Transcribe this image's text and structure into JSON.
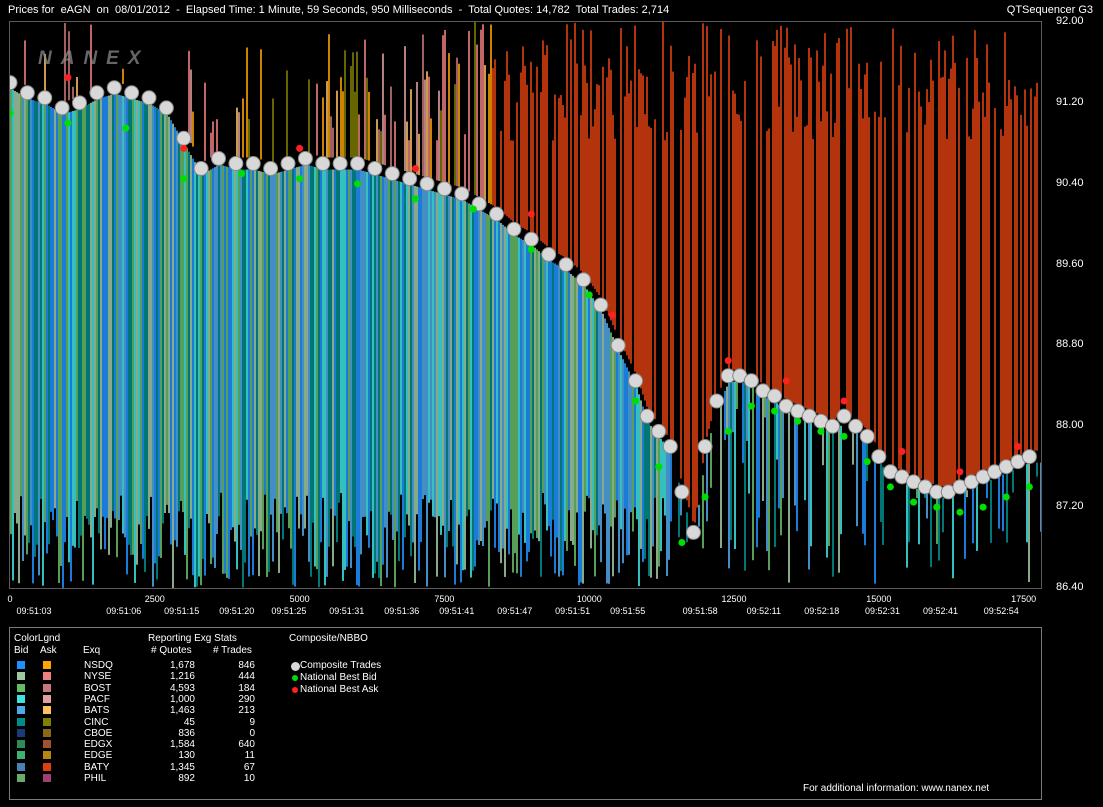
{
  "header": {
    "title": "Prices for  eAGN  on  08/01/2012  -  Elapsed Time: 1 Minute, 59 Seconds, 950 Milliseconds  -  Total Quotes: 14,782  Total Trades: 2,714",
    "app": "QTSequencer G3",
    "watermark": "NANEX"
  },
  "chart_data": {
    "type": "scatter",
    "title": "Prices for eAGN on 08/01/2012",
    "y_ticks": [
      "92.00",
      "91.20",
      "90.40",
      "89.60",
      "88.80",
      "88.00",
      "87.20",
      "86.40"
    ],
    "ylim": [
      86.4,
      92.0
    ],
    "x_numeric_ticks": [
      "0",
      "2500",
      "5000",
      "7500",
      "10000",
      "12500",
      "15000",
      "17500"
    ],
    "xlim": [
      0,
      17800
    ],
    "x_time_ticks": [
      "09:51:03",
      "09:51:06",
      "09:51:15",
      "09:51:20",
      "09:51:25",
      "09:51:31",
      "09:51:36",
      "09:51:41",
      "09:51:47",
      "09:51:51",
      "09:51:55",
      "09:51:58",
      "09:52:11",
      "09:52:18",
      "09:52:31",
      "09:52:41",
      "09:52:54"
    ],
    "x_time_positions": [
      0,
      1550,
      2550,
      3500,
      4400,
      5400,
      6350,
      7300,
      8300,
      9300,
      10250,
      11500,
      12600,
      13600,
      14650,
      15650,
      16700
    ],
    "series": [
      {
        "name": "Composite Trades",
        "color": "#d8d8d8",
        "x": [
          0,
          300,
          600,
          900,
          1200,
          1500,
          1800,
          2100,
          2400,
          2700,
          3000,
          3300,
          3600,
          3900,
          4200,
          4500,
          4800,
          5100,
          5400,
          5700,
          6000,
          6300,
          6600,
          6900,
          7200,
          7500,
          7800,
          8100,
          8400,
          8700,
          9000,
          9300,
          9600,
          9900,
          10200,
          10500,
          10800,
          11000,
          11200,
          11400,
          11600,
          11800,
          12000,
          12200,
          12400,
          12600,
          12800,
          13000,
          13200,
          13400,
          13600,
          13800,
          14000,
          14200,
          14400,
          14600,
          14800,
          15000,
          15200,
          15400,
          15600,
          15800,
          16000,
          16200,
          16400,
          16600,
          16800,
          17000,
          17200,
          17400,
          17600
        ],
        "y": [
          91.4,
          91.3,
          91.25,
          91.15,
          91.2,
          91.3,
          91.35,
          91.3,
          91.25,
          91.15,
          90.85,
          90.55,
          90.65,
          90.6,
          90.6,
          90.55,
          90.6,
          90.65,
          90.6,
          90.6,
          90.6,
          90.55,
          90.5,
          90.45,
          90.4,
          90.35,
          90.3,
          90.2,
          90.1,
          89.95,
          89.85,
          89.7,
          89.6,
          89.45,
          89.2,
          88.8,
          88.45,
          88.1,
          87.95,
          87.8,
          87.35,
          86.95,
          87.8,
          88.25,
          88.5,
          88.5,
          88.45,
          88.35,
          88.3,
          88.2,
          88.15,
          88.1,
          88.05,
          88.0,
          88.1,
          88.0,
          87.9,
          87.7,
          87.55,
          87.5,
          87.45,
          87.4,
          87.35,
          87.35,
          87.4,
          87.45,
          87.5,
          87.55,
          87.6,
          87.65,
          87.7
        ]
      },
      {
        "name": "National Best Bid",
        "color": "#00e000",
        "x": [
          0,
          1000,
          2000,
          3000,
          4000,
          5000,
          6000,
          7000,
          8000,
          9000,
          10000,
          10800,
          11200,
          11600,
          12000,
          12400,
          12800,
          13200,
          13600,
          14000,
          14400,
          14800,
          15200,
          15600,
          16000,
          16400,
          16800,
          17200,
          17600
        ],
        "y": [
          91.1,
          91.0,
          90.95,
          90.45,
          90.5,
          90.45,
          90.4,
          90.25,
          90.15,
          89.75,
          89.3,
          88.25,
          87.6,
          86.85,
          87.3,
          87.95,
          88.2,
          88.15,
          88.05,
          87.95,
          87.9,
          87.65,
          87.4,
          87.25,
          87.2,
          87.15,
          87.2,
          87.3,
          87.4
        ]
      },
      {
        "name": "National Best Ask",
        "color": "#ff2020",
        "x": [
          1000,
          3000,
          5000,
          7000,
          9000,
          10400,
          12400,
          13400,
          14400,
          15400,
          16400,
          17400
        ],
        "y": [
          91.45,
          90.75,
          90.75,
          90.55,
          90.1,
          89.1,
          88.65,
          88.45,
          88.25,
          87.75,
          87.55,
          87.8
        ]
      }
    ],
    "grid": false,
    "legend_position": "bottom-left"
  },
  "legend": {
    "col_headers": {
      "colorlgnd": "ColorLgnd",
      "bid": "Bid",
      "ask": "Ask",
      "exq": "Exq",
      "reporting": "Reporting Exg Stats",
      "quotes": "# Quotes",
      "trades": "# Trades",
      "composite": "Composite/NBBO"
    },
    "rows": [
      {
        "exq": "NSDQ",
        "quotes": "1,678",
        "trades": "846",
        "bid": "#1e90ff",
        "ask": "#ffa500"
      },
      {
        "exq": "NYSE",
        "quotes": "1,216",
        "trades": "444",
        "bid": "#a0c8a0",
        "ask": "#f08080"
      },
      {
        "exq": "BOST",
        "quotes": "4,593",
        "trades": "184",
        "bid": "#66bb66",
        "ask": "#c87878"
      },
      {
        "exq": "PACF",
        "quotes": "1,000",
        "trades": "290",
        "bid": "#40e0e0",
        "ask": "#e0a0a0"
      },
      {
        "exq": "BATS",
        "quotes": "1,463",
        "trades": "213",
        "bid": "#4fa8e8",
        "ask": "#ffc060"
      },
      {
        "exq": "CINC",
        "quotes": "45",
        "trades": "9",
        "bid": "#008b8b",
        "ask": "#808000"
      },
      {
        "exq": "CBOE",
        "quotes": "836",
        "trades": "0",
        "bid": "#1c3a7a",
        "ask": "#8b6914"
      },
      {
        "exq": "EDGX",
        "quotes": "1,584",
        "trades": "640",
        "bid": "#2e8b57",
        "ask": "#a0522d"
      },
      {
        "exq": "EDGE",
        "quotes": "130",
        "trades": "11",
        "bid": "#3cb371",
        "ask": "#b8860b"
      },
      {
        "exq": "BATY",
        "quotes": "1,345",
        "trades": "67",
        "bid": "#4682b4",
        "ask": "#e04010"
      },
      {
        "exq": "PHIL",
        "quotes": "892",
        "trades": "10",
        "bid": "#6aaa6a",
        "ask": "#a04070"
      }
    ],
    "composite_items": [
      {
        "label": "Composite Trades",
        "color": "#d8d8d8",
        "size": 9
      },
      {
        "label": "National Best Bid",
        "color": "#00e000",
        "size": 6
      },
      {
        "label": "National Best Ask",
        "color": "#ff2020",
        "size": 6
      }
    ],
    "footer": "For additional information: www.nanex.net"
  }
}
